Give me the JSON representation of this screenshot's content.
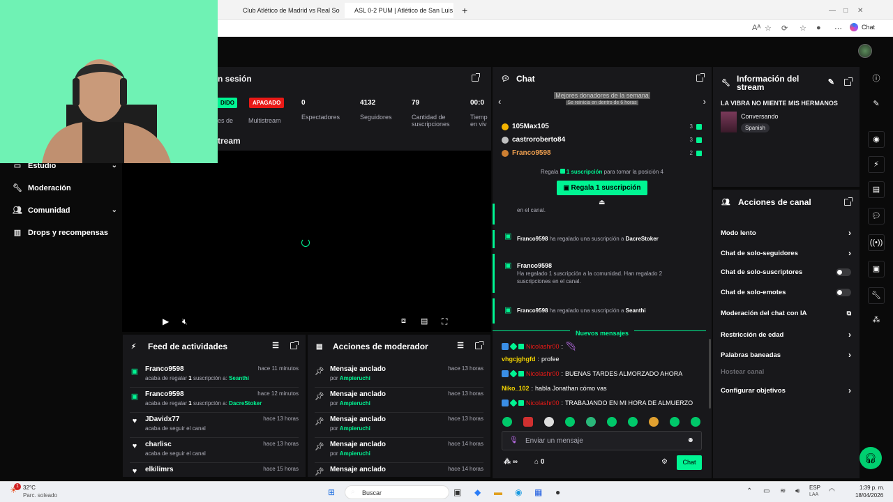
{
  "browser": {
    "tabs": [
      {
        "title": "Club Atlético de Madrid vs Real So",
        "close": "×"
      },
      {
        "title": "ASL 0-2 PUM | Atlético de San Luis",
        "close": "×"
      }
    ],
    "new_tab": "+",
    "copilot": "Chat"
  },
  "left_nav": {
    "items": [
      {
        "label": "Estudio",
        "icon": "chevron",
        "has_chevron": true
      },
      {
        "label": "Moderación",
        "icon": "wrench-icon"
      },
      {
        "label": "Comunidad",
        "icon": "community-icon",
        "has_chevron": true
      },
      {
        "label": "Drops y recompensas",
        "icon": "drops-icon"
      }
    ]
  },
  "session": {
    "title_partial": "n sesión",
    "status_badge_partial": "DIDO",
    "status_label_partial": "es de",
    "multistream_badge": "APAGADO",
    "multistream_label": "Multistream",
    "stats": [
      {
        "value": "0",
        "label": "Espectadores"
      },
      {
        "value": "4132",
        "label": "Seguidores"
      },
      {
        "value": "79",
        "label": "Cantidad de suscripciones"
      },
      {
        "value": "00:0",
        "label": "Tiemp en viv"
      }
    ]
  },
  "preview": {
    "title_partial": "tream"
  },
  "feed": {
    "title": "Feed de actividades",
    "items": [
      {
        "icon": "gift",
        "name": "Franco9598",
        "time": "hace 11 minutos",
        "pre": "acaba de regalar ",
        "count": "1",
        "mid": " suscripción a: ",
        "target": "Seanthi"
      },
      {
        "icon": "gift",
        "name": "Franco9598",
        "time": "hace 12 minutos",
        "pre": "acaba de regalar ",
        "count": "1",
        "mid": " suscripción a: ",
        "target": "DacreStoker"
      },
      {
        "icon": "heart",
        "name": "JDavidx77",
        "time": "hace 13 horas",
        "pre": "acaba de seguir el canal"
      },
      {
        "icon": "heart",
        "name": "charlisc",
        "time": "hace 13 horas",
        "pre": "acaba de seguir el canal"
      },
      {
        "icon": "heart",
        "name": "elkilimrs",
        "time": "hace 15 horas",
        "pre": ""
      }
    ]
  },
  "mod_actions": {
    "title": "Acciones de moderador",
    "items": [
      {
        "name": "Mensaje anclado",
        "by": "por ",
        "user": "Ampieruchi",
        "time": "hace 13 horas"
      },
      {
        "name": "Mensaje anclado",
        "by": "por ",
        "user": "Ampieruchi",
        "time": "hace 13 horas"
      },
      {
        "name": "Mensaje anclado",
        "by": "por ",
        "user": "Ampieruchi",
        "time": "hace 13 horas"
      },
      {
        "name": "Mensaje anclado",
        "by": "por ",
        "user": "Ampieruchi",
        "time": "hace 14 horas"
      },
      {
        "name": "Mensaje anclado",
        "by": "",
        "user": "",
        "time": "hace 14 horas"
      }
    ]
  },
  "chat": {
    "title": "Chat",
    "donors_title": "Mejores donadores de la semana",
    "donors_subtitle": "Se reinicia en dentro de 6 horas",
    "donors": [
      {
        "name": "105Max105",
        "count": "3",
        "medal": "#f5b400"
      },
      {
        "name": "castroroberto84",
        "count": "3",
        "medal": "#c0c0c0"
      },
      {
        "name": "Franco9598",
        "count": "2",
        "medal": "#cd7f32"
      }
    ],
    "cta_pre": "Regala ",
    "cta_link": "1 suscripción",
    "cta_post": " para tomar la posición 4",
    "cta_button": "Regala 1 suscripción",
    "partial_msg": "en el canal.",
    "gift_msgs": [
      {
        "user": "Franco9598",
        "text": " ha regalado una suscripción a ",
        "target": "DacreStoker"
      },
      {
        "user": "Franco9598",
        "text": "Ha regalado 1 suscripción a la comunidad. Han regalado 2 suscripciones en el canal."
      },
      {
        "user": "Franco9598",
        "text": " ha regalado una suscripción a ",
        "target": "Seanthi"
      }
    ],
    "new_messages": "Nuevos mensajes",
    "messages": [
      {
        "user": "Nicolashr00",
        "text": "",
        "badges": true,
        "color": "red"
      },
      {
        "user": "vhgcjghgfd",
        "text": "profee",
        "color": "y"
      },
      {
        "user": "Nicolashr00",
        "text": "BUENAS TARDES ALMORZADO AHORA",
        "badges": true,
        "color": "red"
      },
      {
        "user": "Niko_102",
        "text": "habla Jonathan cómo vas",
        "color": "y"
      },
      {
        "user": "Nicolashr00",
        "text": "TRABAJANDO EN MI HORA DE ALMUERZO",
        "badges": true,
        "color": "red"
      }
    ],
    "input_placeholder": "Enviar un mensaje",
    "points": "∞",
    "gifts_count": "0",
    "send_button": "Chat"
  },
  "stream_info": {
    "title": "Información del stream",
    "stream_title": "LA VIBRA NO MIENTE MIS HERMANOS",
    "category": "Conversando",
    "tag": "Spanish"
  },
  "channel_actions": {
    "title": "Acciones de canal",
    "items": [
      {
        "label": "Modo lento",
        "control": "arrow"
      },
      {
        "label": "Chat de solo-seguidores",
        "control": "arrow"
      },
      {
        "label": "Chat de solo-suscriptores",
        "control": "toggle"
      },
      {
        "label": "Chat de solo-emotes",
        "control": "toggle"
      },
      {
        "label": "Moderación del chat con IA",
        "control": "external"
      },
      {
        "label": "Restricción de edad",
        "control": "arrow"
      },
      {
        "label": "Palabras baneadas",
        "control": "arrow"
      },
      {
        "label": "Hostear canal",
        "control": "none",
        "disabled": true
      },
      {
        "label": "Configurar objetivos",
        "control": "arrow"
      }
    ]
  },
  "taskbar": {
    "weather_temp": "32°C",
    "weather_desc": "Parc. soleado",
    "notification_count": "1",
    "search_label": "Buscar",
    "lang": "ESP",
    "lang_sub": "LAA",
    "time": "1:39 p. m.",
    "date": "18/04/2026"
  },
  "colors": {
    "accent": "#00f593",
    "bg": "#0a0a0a",
    "panel": "#18181b",
    "danger": "#e91916"
  }
}
